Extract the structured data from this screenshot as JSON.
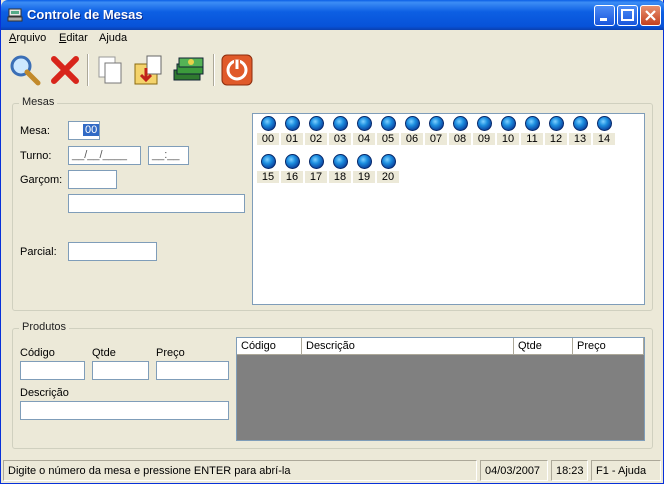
{
  "window": {
    "title": "Controle de Mesas"
  },
  "menu": [
    {
      "pre": "",
      "ul": "A",
      "post": "rquivo"
    },
    {
      "pre": "",
      "ul": "E",
      "post": "ditar"
    },
    {
      "pre": "A",
      "ul": "j",
      "post": "uda"
    }
  ],
  "toolbar_icons": [
    "search-icon",
    "delete-icon",
    "copy-icon",
    "add-item-icon",
    "money-icon",
    "power-icon"
  ],
  "mesas": {
    "group_title": "Mesas",
    "mesa_label": "Mesa:",
    "mesa_value": "00",
    "turno_label": "Turno:",
    "turno_date_mask": "__/__/____",
    "turno_time_mask": "__:__",
    "garcom_label": "Garçom:",
    "parcial_label": "Parcial:",
    "tables": [
      "00",
      "01",
      "02",
      "03",
      "04",
      "05",
      "06",
      "07",
      "08",
      "09",
      "10",
      "11",
      "12",
      "13",
      "14",
      "15",
      "16",
      "17",
      "18",
      "19",
      "20"
    ]
  },
  "produtos": {
    "group_title": "Produtos",
    "codigo_label": "Código",
    "qtde_label": "Qtde",
    "preco_label": "Preço",
    "descricao_label": "Descrição",
    "grid_columns": [
      "Código",
      "Descrição",
      "Qtde",
      "Preço"
    ]
  },
  "status": {
    "message": "Digite o número da mesa e pressione ENTER para abrí-la",
    "date": "04/03/2007",
    "time": "18:23",
    "help": "F1 - Ajuda"
  },
  "colors": {
    "titlebar": "#0A5FE6",
    "accent": "#316AC5",
    "table_icon": "#1D8FE0"
  }
}
